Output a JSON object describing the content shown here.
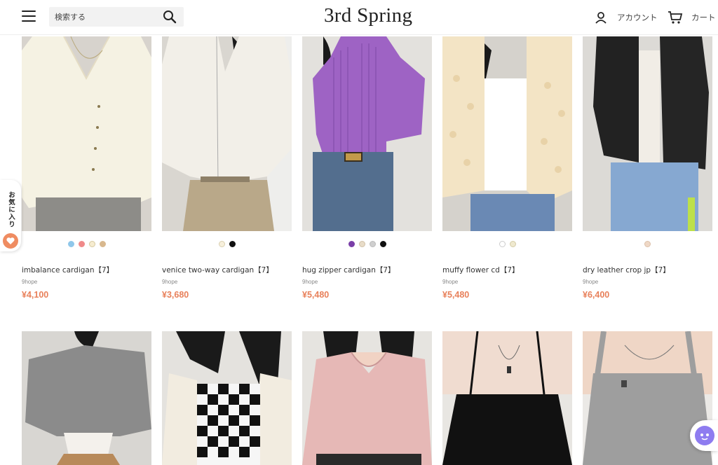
{
  "header": {
    "search_placeholder": "検索する",
    "logo": "3rd Spring",
    "account_label": "アカウント",
    "cart_label": "カート"
  },
  "fav_tab": {
    "label": "お気に入り"
  },
  "products": [
    {
      "name": "imbalance cardigan【7】",
      "brand": "9hope",
      "price": "¥4,100",
      "swatches": [
        "#8fc7ea",
        "#f08a8a",
        "#f6ecd0",
        "#d8b88e"
      ]
    },
    {
      "name": "venice two-way cardigan【7】",
      "brand": "9hope",
      "price": "¥3,680",
      "swatches": [
        "#f7f0dc",
        "#111111"
      ]
    },
    {
      "name": "hug zipper cardigan【7】",
      "brand": "9hope",
      "price": "¥5,480",
      "swatches": [
        "#7a3fa8",
        "#e8dcc8",
        "#cfcfcf",
        "#111111"
      ]
    },
    {
      "name": "muffy flower cd【7】",
      "brand": "9hope",
      "price": "¥5,480",
      "swatches": [
        "#ffffff",
        "#efe9cf"
      ]
    },
    {
      "name": "dry leather crop jp【7】",
      "brand": "9hope",
      "price": "¥6,400",
      "swatches": [
        "#efd8c6"
      ]
    },
    {
      "name": "",
      "brand": "",
      "price": "",
      "swatches": []
    },
    {
      "name": "",
      "brand": "",
      "price": "",
      "swatches": []
    },
    {
      "name": "",
      "brand": "",
      "price": "",
      "swatches": []
    },
    {
      "name": "",
      "brand": "",
      "price": "",
      "swatches": []
    },
    {
      "name": "",
      "brand": "",
      "price": "",
      "swatches": []
    }
  ],
  "colors": {
    "price": "#e8805a",
    "fav_heart": "#ef8c61",
    "chat": "#8e7cf0"
  },
  "icons": [
    "menu-icon",
    "search-icon",
    "account-icon",
    "cart-icon",
    "heart-icon",
    "chat-icon"
  ]
}
